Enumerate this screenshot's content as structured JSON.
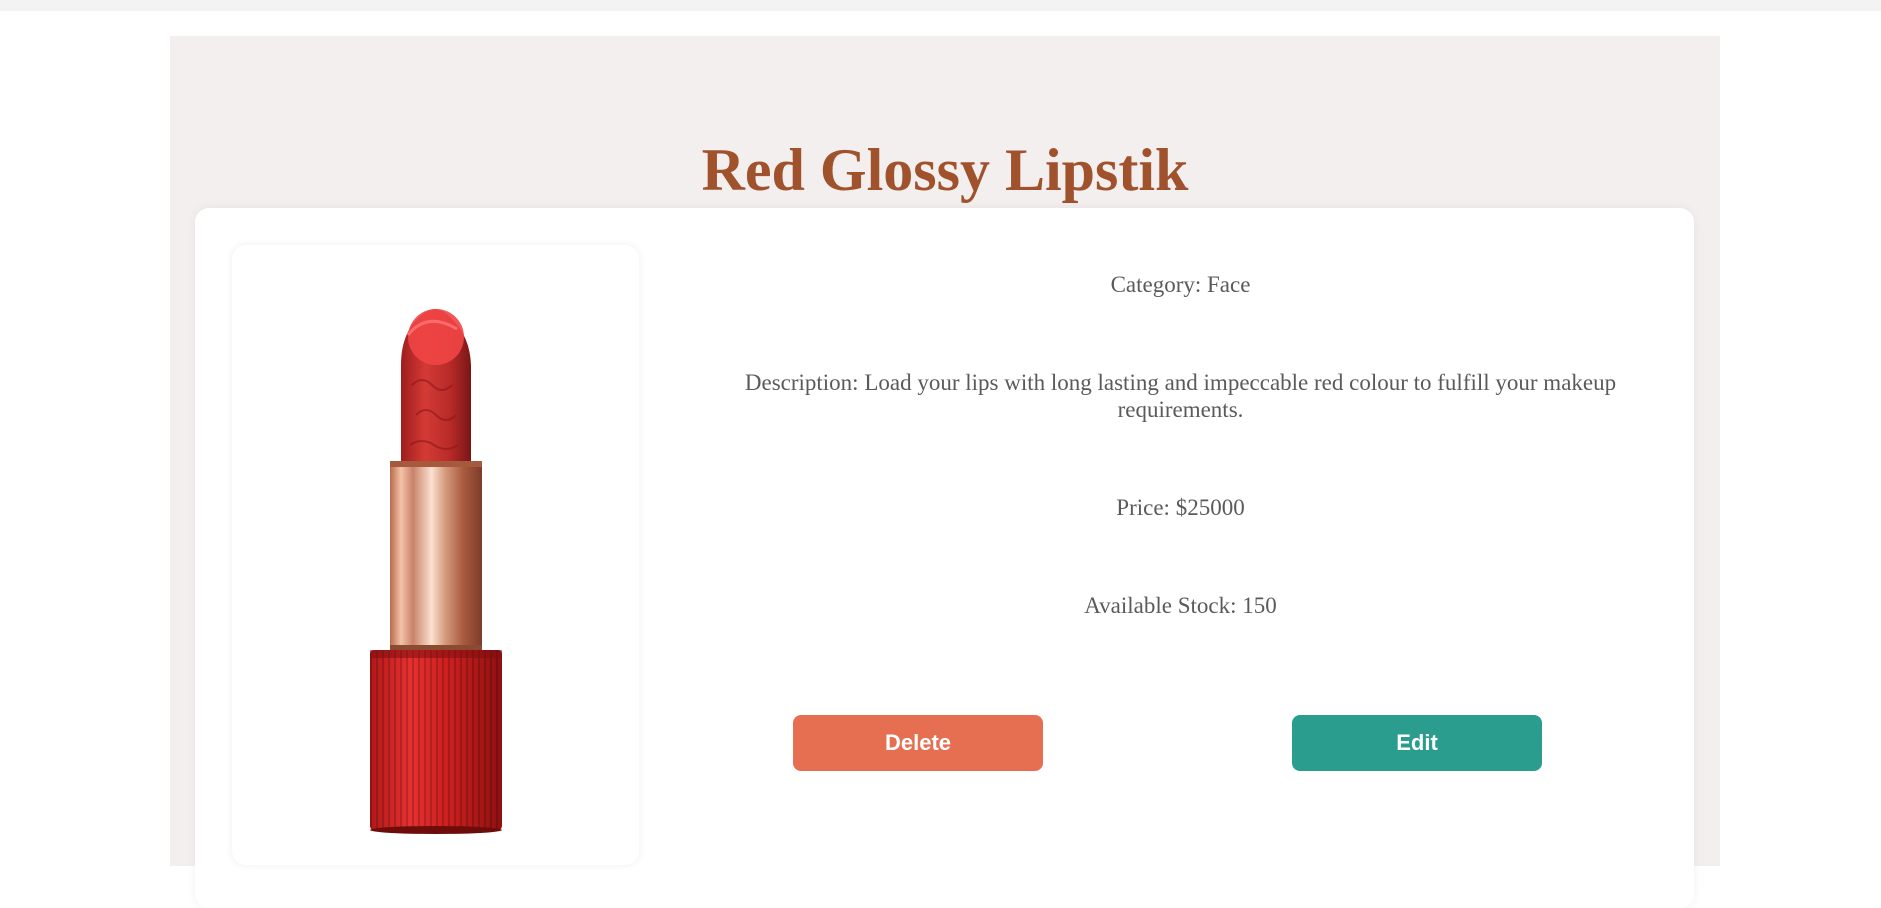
{
  "product": {
    "title": "Red Glossy Lipstik",
    "image_alt": "Red glossy lipstick with rose-gold sleeve and ribbed red base",
    "category": "Category: Face",
    "description": "Description: Load your lips with long lasting and impeccable red colour to fulfill your makeup requirements.",
    "price": "Price: $25000",
    "stock": "Available Stock: 150"
  },
  "actions": {
    "delete_label": "Delete",
    "edit_label": "Edit"
  },
  "colors": {
    "title": "#a0522d",
    "page_bg": "#f3efee",
    "delete": "#e76f51",
    "edit": "#2a9d8f",
    "text": "#5a5a5a"
  }
}
